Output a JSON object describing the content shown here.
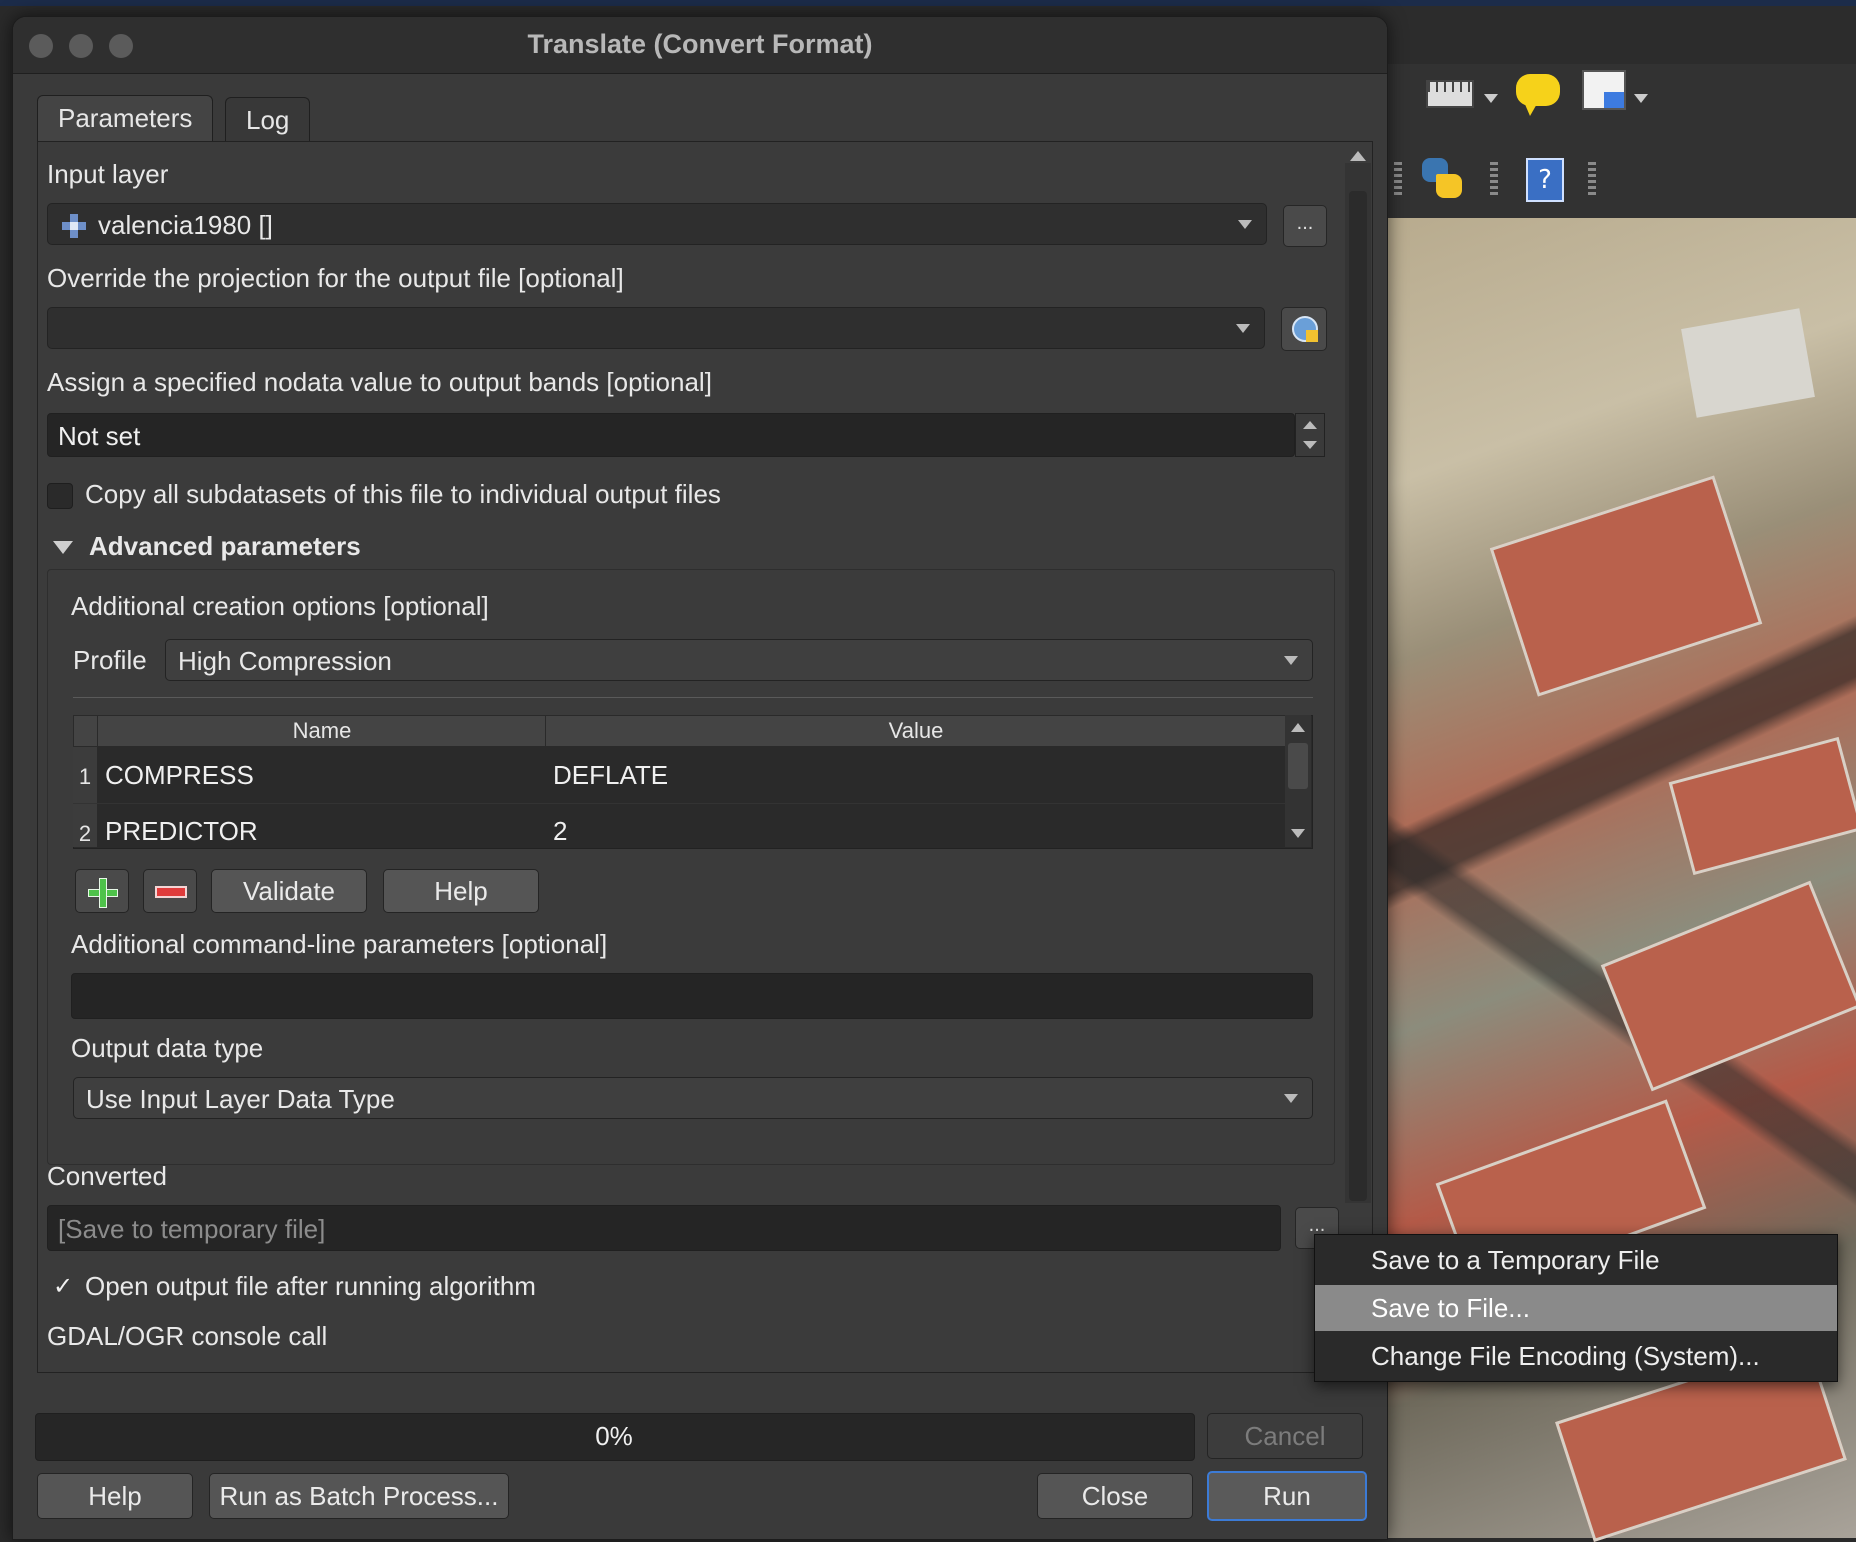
{
  "dialog": {
    "title": "Translate (Convert Format)",
    "tabs": [
      {
        "label": "Parameters"
      },
      {
        "label": "Log"
      }
    ]
  },
  "params": {
    "input_layer_label": "Input layer",
    "input_layer_value": "valencia1980 []",
    "browse_label": "...",
    "projection_label": "Override the projection for the output file [optional]",
    "projection_value": "",
    "nodata_label": "Assign a specified nodata value to output bands [optional]",
    "nodata_value": "Not set",
    "copy_subdatasets_label": "Copy all subdatasets of this file to individual output files",
    "copy_subdatasets_checked": false,
    "advanced_label": "Advanced parameters",
    "creation_options_label": "Additional creation options [optional]",
    "profile_label": "Profile",
    "profile_value": "High Compression",
    "table": {
      "headers": [
        "Name",
        "Value"
      ],
      "rows": [
        {
          "index": "1",
          "name": "COMPRESS",
          "value": "DEFLATE"
        },
        {
          "index": "2",
          "name": "PREDICTOR",
          "value": "2"
        }
      ]
    },
    "validate_label": "Validate",
    "help_small_label": "Help",
    "cmdline_label": "Additional command-line parameters [optional]",
    "cmdline_value": "",
    "datatype_label": "Output data type",
    "datatype_value": "Use Input Layer Data Type",
    "converted_label": "Converted",
    "converted_placeholder": "[Save to temporary file]",
    "open_output_label": "Open output file after running algorithm",
    "open_output_check": "✓",
    "gdal_label": "GDAL/OGR console call"
  },
  "footer": {
    "progress_text": "0%",
    "progress": 0,
    "cancel_label": "Cancel",
    "help_label": "Help",
    "batch_label": "Run as Batch Process...",
    "close_label": "Close",
    "run_label": "Run"
  },
  "menu": {
    "items": [
      {
        "label": "Save to a Temporary File"
      },
      {
        "label": "Save to File..."
      },
      {
        "label": "Change File Encoding (System)..."
      }
    ],
    "selected_index": 1
  },
  "icons": {
    "raster_layer": "raster-layer-icon",
    "crs_globe": "crs-globe-icon",
    "add": "add-row-icon",
    "remove": "remove-row-icon",
    "python": "python-console-icon",
    "help": "help-icon",
    "ruler": "measure-icon",
    "tooltip": "map-tips-icon",
    "annotation": "annotation-icon"
  },
  "colors": {
    "dialog_bg": "#3a3a3a",
    "field_bg": "#252525",
    "run_border": "#3c7bd6",
    "menu_highlight": "#8a8a8a"
  }
}
